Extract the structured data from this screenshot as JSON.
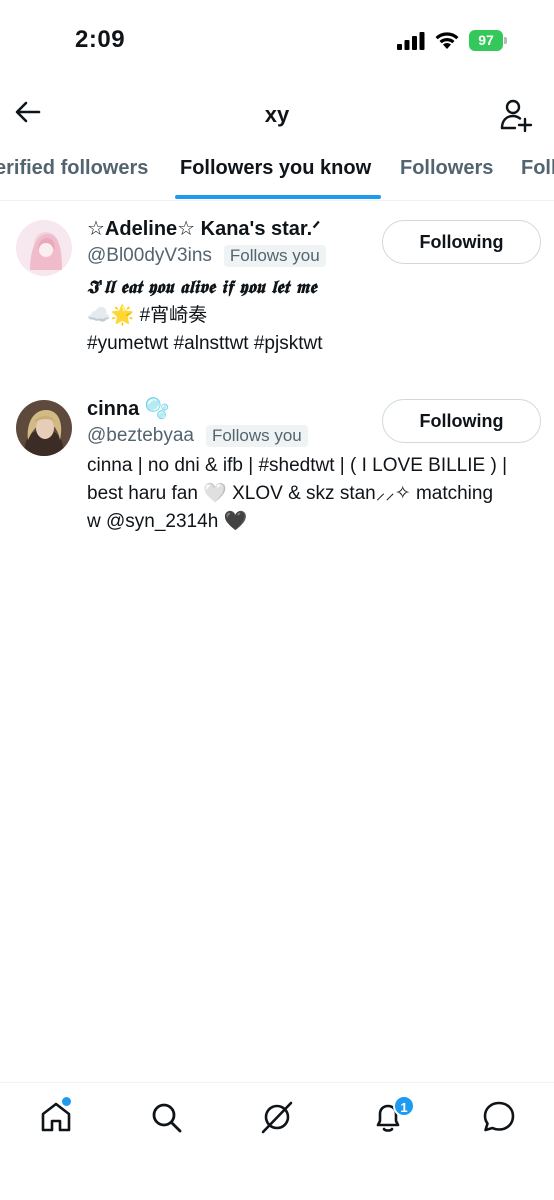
{
  "status_bar": {
    "time": "2:09",
    "battery": "97"
  },
  "header": {
    "title": "xy"
  },
  "tabs": [
    {
      "label": "erified followers"
    },
    {
      "label": "Followers you know",
      "active": true
    },
    {
      "label": "Followers"
    },
    {
      "label": "Foll"
    }
  ],
  "users": [
    {
      "display_name": "☆Adeline☆ Kana's star.ᐟ",
      "handle": "@Bl00dyV3ins",
      "follows_badge": "Follows you",
      "button_label": "Following",
      "bio": [
        "𝕴'𝖑𝖑 𝖊𝖆𝖙 𝖞𝖔𝖚 𝖆𝖑𝖎𝖛𝖊 𝖎𝖋 𝖞𝖔𝖚 𝖑𝖊𝖙 𝖒𝖊",
        "☁️🌟 #宵崎奏",
        "#yumetwt #alnsttwt #pjsktwt"
      ]
    },
    {
      "display_name": "cinna 🫧",
      "handle": "@beztebyaa",
      "follows_badge": "Follows you",
      "button_label": "Following",
      "bio": [
        "cinna | no dni & ifb | #shedtwt | ( I LOVE BILLIE ) |",
        "best haru fan 🤍 XLOV & skz stan⸝⸝✧ matching",
        "w @syn_2314h 🖤"
      ]
    }
  ],
  "bottom_nav": {
    "notifications_count": "1",
    "items": [
      "home-icon",
      "search-icon",
      "grok-icon",
      "notifications-icon",
      "messages-icon"
    ]
  },
  "colors": {
    "accent": "#1d9bf0",
    "secondary_text": "#536471",
    "battery": "#34c759"
  }
}
